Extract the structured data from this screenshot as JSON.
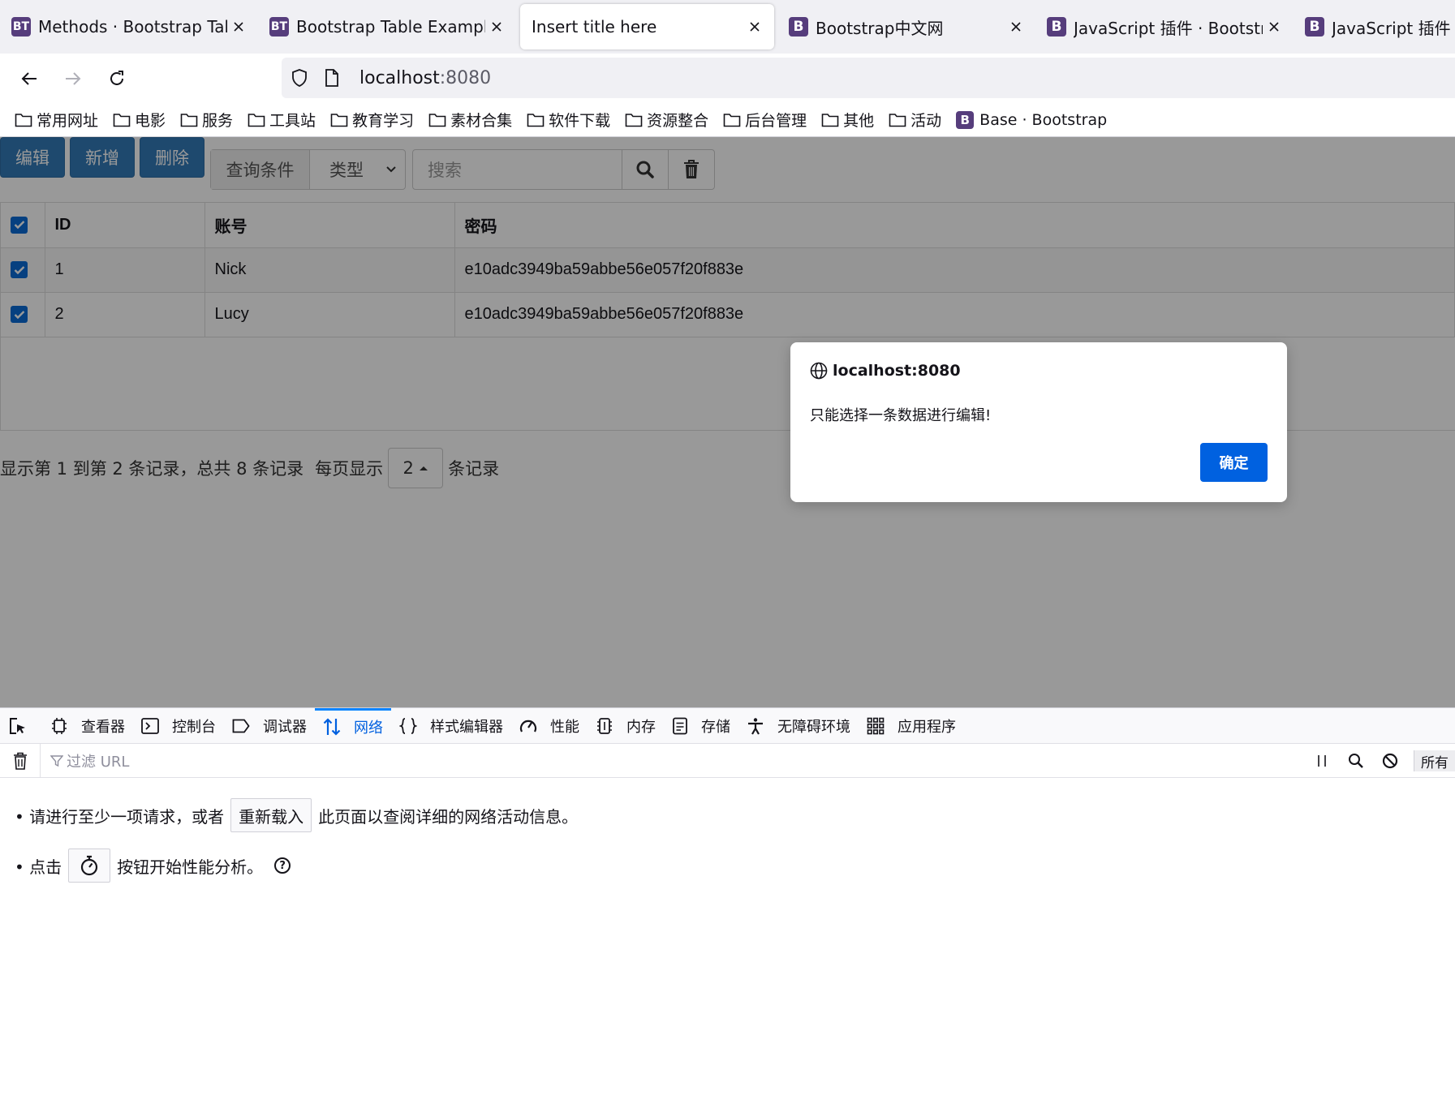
{
  "browser": {
    "tabs": [
      {
        "favicon": "BT",
        "title": "Methods · Bootstrap Table",
        "active": false
      },
      {
        "favicon": "BT",
        "title": "Bootstrap Table Examples",
        "active": false
      },
      {
        "favicon": "",
        "title": "Insert title here",
        "active": true
      },
      {
        "favicon": "B",
        "title": "Bootstrap中文网",
        "active": false
      },
      {
        "favicon": "B",
        "title": "JavaScript 插件 · Bootstrap v",
        "active": false
      },
      {
        "favicon": "B",
        "title": "JavaScript 插件 · B",
        "active": false
      }
    ],
    "url_host": "localhost",
    "url_port": ":8080",
    "bookmarks": [
      "常用网址",
      "电影",
      "服务",
      "工具站",
      "教育学习",
      "素材合集",
      "软件下载",
      "资源整合",
      "后台管理",
      "其他",
      "活动"
    ],
    "bookmark_site": {
      "favicon": "B",
      "label": "Base · Bootstrap"
    }
  },
  "page": {
    "toolbar": {
      "edit": "编辑",
      "add": "新增",
      "delete": "删除",
      "query_label": "查询条件",
      "type_select": "类型",
      "search_placeholder": "搜索"
    },
    "table": {
      "headers": [
        "ID",
        "账号",
        "密码"
      ],
      "rows": [
        {
          "id": "1",
          "account": "Nick",
          "password": "e10adc3949ba59abbe56e057f20f883e",
          "checked": true
        },
        {
          "id": "2",
          "account": "Lucy",
          "password": "e10adc3949ba59abbe56e057f20f883e",
          "checked": true
        }
      ]
    },
    "pagination": {
      "summary": "显示第 1 到第 2 条记录，总共 8 条记录",
      "per_page_prefix": "每页显示",
      "per_page_value": "2",
      "per_page_suffix": "条记录"
    }
  },
  "dialog": {
    "origin": "localhost:8080",
    "message": "只能选择一条数据进行编辑!",
    "ok": "确定"
  },
  "devtools": {
    "tabs": [
      "查看器",
      "控制台",
      "调试器",
      "网络",
      "样式编辑器",
      "性能",
      "内存",
      "存储",
      "无障碍环境",
      "应用程序"
    ],
    "selected_tab": "网络",
    "filter_placeholder": "过滤 URL",
    "all_label": "所有",
    "hint1_prefix": "• 请进行至少一项请求，或者",
    "hint1_button": "重新载入",
    "hint1_suffix": "此页面以查阅详细的网络活动信息。",
    "hint2_prefix": "• 点击",
    "hint2_suffix": "按钮开始性能分析。"
  },
  "colors": {
    "primary_button": "#337ab7",
    "dialog_ok": "#0061e0",
    "checkbox": "#0a6cd6",
    "devtools_selected": "#0060df"
  }
}
